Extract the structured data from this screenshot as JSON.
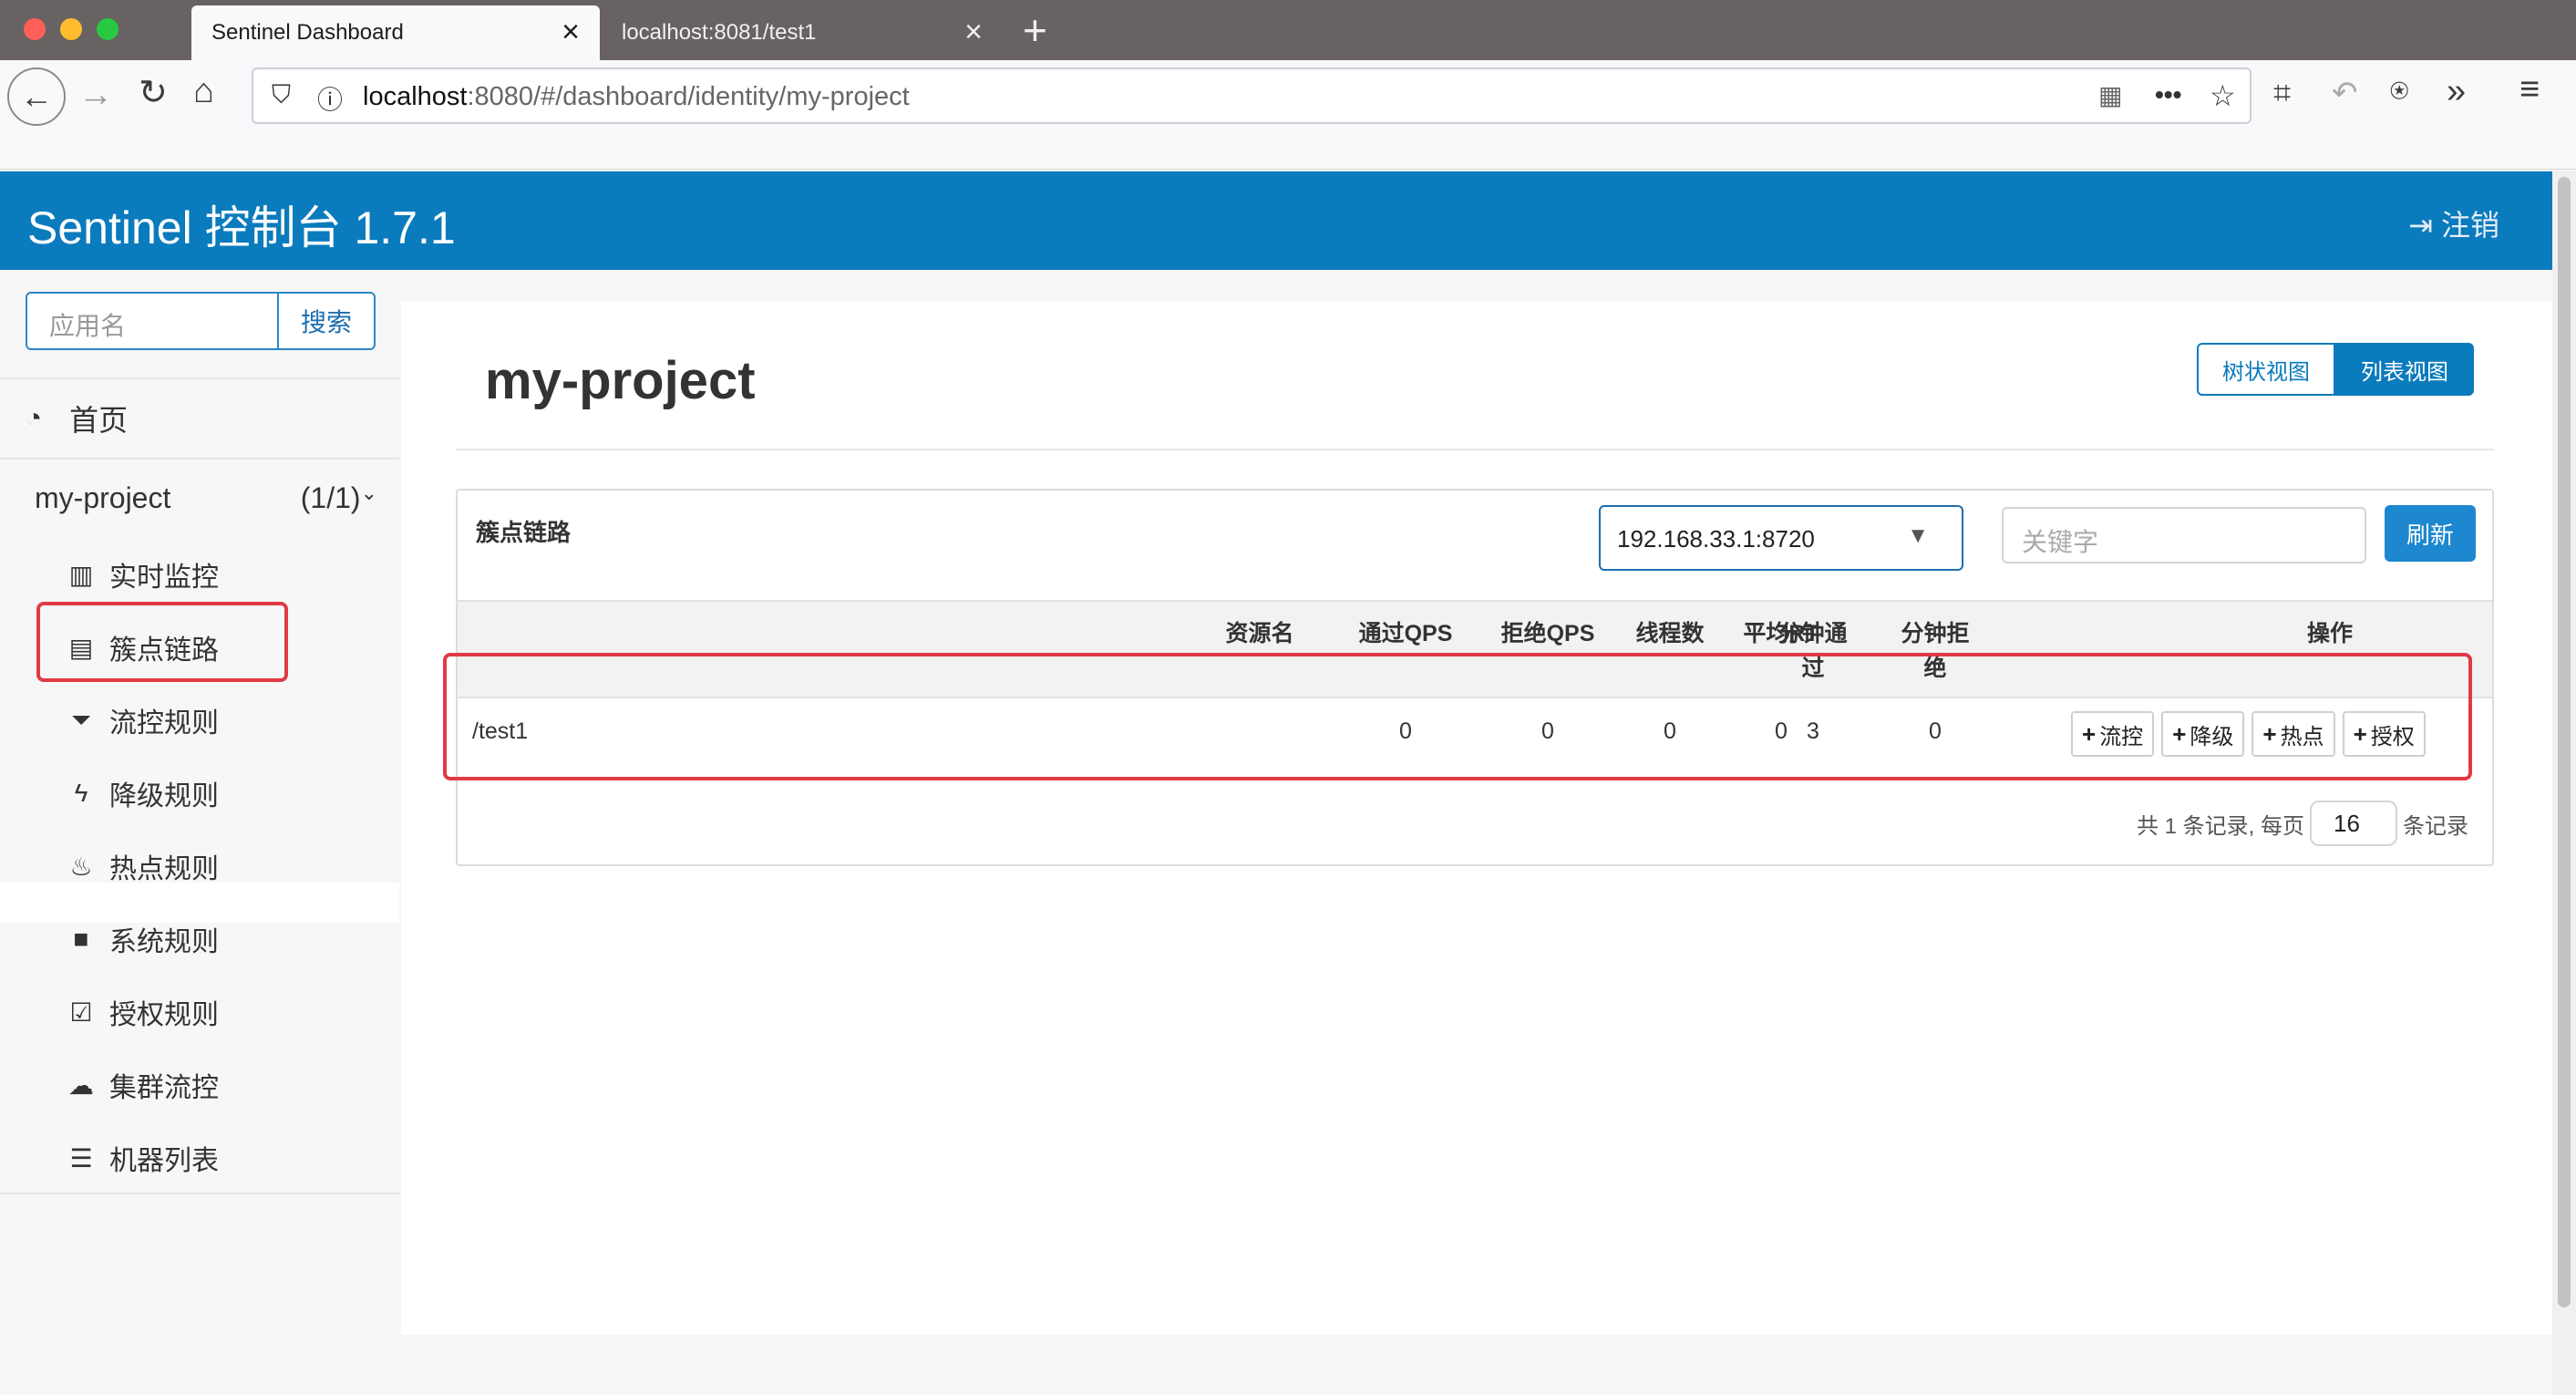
{
  "browser": {
    "tabs": [
      {
        "title": "Sentinel Dashboard",
        "active": true
      },
      {
        "title": "localhost:8081/test1",
        "active": false
      }
    ],
    "url_host": "localhost",
    "url_rest": ":8080/#/dashboard/identity/my-project"
  },
  "header": {
    "title": "Sentinel 控制台 1.7.1",
    "logout_label": "注销"
  },
  "sidebar": {
    "search_placeholder": "应用名",
    "search_button": "搜索",
    "home_label": "首页",
    "app_name": "my-project",
    "app_count": "(1/1)",
    "items": [
      {
        "label": "实时监控",
        "icon": "bar-chart-icon"
      },
      {
        "label": "簇点链路",
        "icon": "list-icon"
      },
      {
        "label": "流控规则",
        "icon": "filter-icon"
      },
      {
        "label": "降级规则",
        "icon": "flash-icon"
      },
      {
        "label": "热点规则",
        "icon": "fire-icon"
      },
      {
        "label": "系统规则",
        "icon": "lock-icon"
      },
      {
        "label": "授权规则",
        "icon": "check-icon"
      },
      {
        "label": "集群流控",
        "icon": "cloud-icon"
      },
      {
        "label": "机器列表",
        "icon": "th-list-icon"
      }
    ]
  },
  "main": {
    "page_title": "my-project",
    "tree_view_label": "树状视图",
    "list_view_label": "列表视图",
    "panel_title": "簇点链路",
    "machine_selected": "192.168.33.1:8720",
    "keyword_placeholder": "关键字",
    "refresh_label": "刷新",
    "columns": {
      "resource": "资源名",
      "pass_qps": "通过QPS",
      "block_qps": "拒绝QPS",
      "threads": "线程数",
      "avg_rt": "平均RT",
      "minute_pass": "分钟通过",
      "minute_block": "分钟拒绝",
      "ops": "操作"
    },
    "rows": [
      {
        "resource": "/test1",
        "pass_qps": "0",
        "block_qps": "0",
        "threads": "0",
        "avg_rt": "0",
        "minute_pass": "3",
        "minute_block": "0"
      }
    ],
    "op_buttons": [
      "流控",
      "降级",
      "热点",
      "授权"
    ],
    "pager": {
      "prefix": "共 1 条记录, 每页",
      "page_size": "16",
      "suffix": "条记录"
    }
  },
  "colors": {
    "brand": "#0a7bbd",
    "annotation": "#e03a45"
  }
}
